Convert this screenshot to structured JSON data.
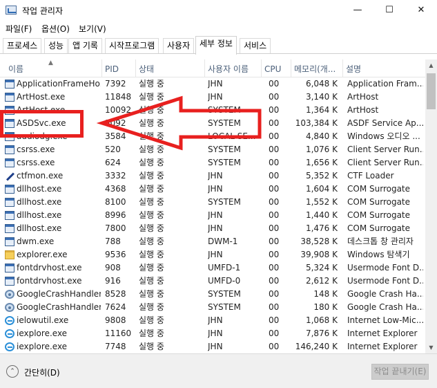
{
  "window": {
    "title": "작업 관리자",
    "minimize": "—",
    "maximize": "☐",
    "close": "✕"
  },
  "menu": [
    "파일(F)",
    "옵션(O)",
    "보기(V)"
  ],
  "tabs": [
    "프로세스",
    "성능",
    "앱 기록",
    "시작프로그램",
    "사용자",
    "세부 정보",
    "서비스"
  ],
  "active_tab": "세부 정보",
  "columns": [
    "이름",
    "PID",
    "상태",
    "사용자 이름",
    "CPU",
    "메모리(개...",
    "설명"
  ],
  "rows": [
    {
      "icon": "app",
      "name": "ApplicationFrameHo...",
      "pid": "7392",
      "status": "실행 중",
      "user": "JHN",
      "cpu": "00",
      "mem": "6,048 K",
      "desc": "Application Fram..."
    },
    {
      "icon": "app",
      "name": "ArtHost.exe",
      "pid": "11848",
      "status": "실행 중",
      "user": "JHN",
      "cpu": "00",
      "mem": "3,140 K",
      "desc": "ArtHost"
    },
    {
      "icon": "app",
      "name": "ArtHost.exe",
      "pid": "10092",
      "status": "실행 중",
      "user": "SYSTEM",
      "cpu": "00",
      "mem": "1,364 K",
      "desc": "ArtHost"
    },
    {
      "icon": "app",
      "name": "ASDSvc.exe",
      "pid": "3092",
      "status": "실행 중",
      "user": "SYSTEM",
      "cpu": "00",
      "mem": "103,384 K",
      "desc": "ASDF Service Ap..."
    },
    {
      "icon": "app",
      "name": "audiodg.exe",
      "pid": "3584",
      "status": "실행 중",
      "user": "LOCAL SE...",
      "cpu": "00",
      "mem": "4,840 K",
      "desc": "Windows 오디오 ..."
    },
    {
      "icon": "app",
      "name": "csrss.exe",
      "pid": "520",
      "status": "실행 중",
      "user": "SYSTEM",
      "cpu": "00",
      "mem": "1,076 K",
      "desc": "Client Server Run..."
    },
    {
      "icon": "app",
      "name": "csrss.exe",
      "pid": "624",
      "status": "실행 중",
      "user": "SYSTEM",
      "cpu": "00",
      "mem": "1,656 K",
      "desc": "Client Server Run..."
    },
    {
      "icon": "pen",
      "name": "ctfmon.exe",
      "pid": "3332",
      "status": "실행 중",
      "user": "JHN",
      "cpu": "00",
      "mem": "5,352 K",
      "desc": "CTF Loader"
    },
    {
      "icon": "app",
      "name": "dllhost.exe",
      "pid": "4368",
      "status": "실행 중",
      "user": "JHN",
      "cpu": "00",
      "mem": "1,604 K",
      "desc": "COM Surrogate"
    },
    {
      "icon": "app",
      "name": "dllhost.exe",
      "pid": "8100",
      "status": "실행 중",
      "user": "SYSTEM",
      "cpu": "00",
      "mem": "1,552 K",
      "desc": "COM Surrogate"
    },
    {
      "icon": "app",
      "name": "dllhost.exe",
      "pid": "8996",
      "status": "실행 중",
      "user": "JHN",
      "cpu": "00",
      "mem": "1,440 K",
      "desc": "COM Surrogate"
    },
    {
      "icon": "app",
      "name": "dllhost.exe",
      "pid": "7800",
      "status": "실행 중",
      "user": "JHN",
      "cpu": "00",
      "mem": "1,476 K",
      "desc": "COM Surrogate"
    },
    {
      "icon": "app",
      "name": "dwm.exe",
      "pid": "788",
      "status": "실행 중",
      "user": "DWM-1",
      "cpu": "00",
      "mem": "38,528 K",
      "desc": "데스크톱 창 관리자"
    },
    {
      "icon": "folder",
      "name": "explorer.exe",
      "pid": "9536",
      "status": "실행 중",
      "user": "JHN",
      "cpu": "00",
      "mem": "39,908 K",
      "desc": "Windows 탐색기"
    },
    {
      "icon": "app",
      "name": "fontdrvhost.exe",
      "pid": "908",
      "status": "실행 중",
      "user": "UMFD-1",
      "cpu": "00",
      "mem": "5,324 K",
      "desc": "Usermode Font D..."
    },
    {
      "icon": "app",
      "name": "fontdrvhost.exe",
      "pid": "916",
      "status": "실행 중",
      "user": "UMFD-0",
      "cpu": "00",
      "mem": "2,612 K",
      "desc": "Usermode Font D..."
    },
    {
      "icon": "gear",
      "name": "GoogleCrashHandler....",
      "pid": "8528",
      "status": "실행 중",
      "user": "SYSTEM",
      "cpu": "00",
      "mem": "148 K",
      "desc": "Google Crash Ha..."
    },
    {
      "icon": "gear",
      "name": "GoogleCrashHandler....",
      "pid": "7624",
      "status": "실행 중",
      "user": "SYSTEM",
      "cpu": "00",
      "mem": "180 K",
      "desc": "Google Crash Ha..."
    },
    {
      "icon": "ie",
      "name": "ielowutil.exe",
      "pid": "9808",
      "status": "실행 중",
      "user": "JHN",
      "cpu": "00",
      "mem": "1,068 K",
      "desc": "Internet Low-Mic..."
    },
    {
      "icon": "ie",
      "name": "iexplore.exe",
      "pid": "11160",
      "status": "실행 중",
      "user": "JHN",
      "cpu": "00",
      "mem": "7,876 K",
      "desc": "Internet Explorer"
    },
    {
      "icon": "ie",
      "name": "iexplore.exe",
      "pid": "7748",
      "status": "실행 중",
      "user": "JHN",
      "cpu": "00",
      "mem": "146,240 K",
      "desc": "Internet Explorer"
    }
  ],
  "footer": {
    "collapse_label": "간단히(D)",
    "end_task_label": "작업 끝내기(E)"
  },
  "colors": {
    "annotation": "#e8201f",
    "header_text": "#4c607a"
  },
  "icons": [
    "app-icon",
    "collapse-chevron-icon",
    "arrow-annotation"
  ]
}
